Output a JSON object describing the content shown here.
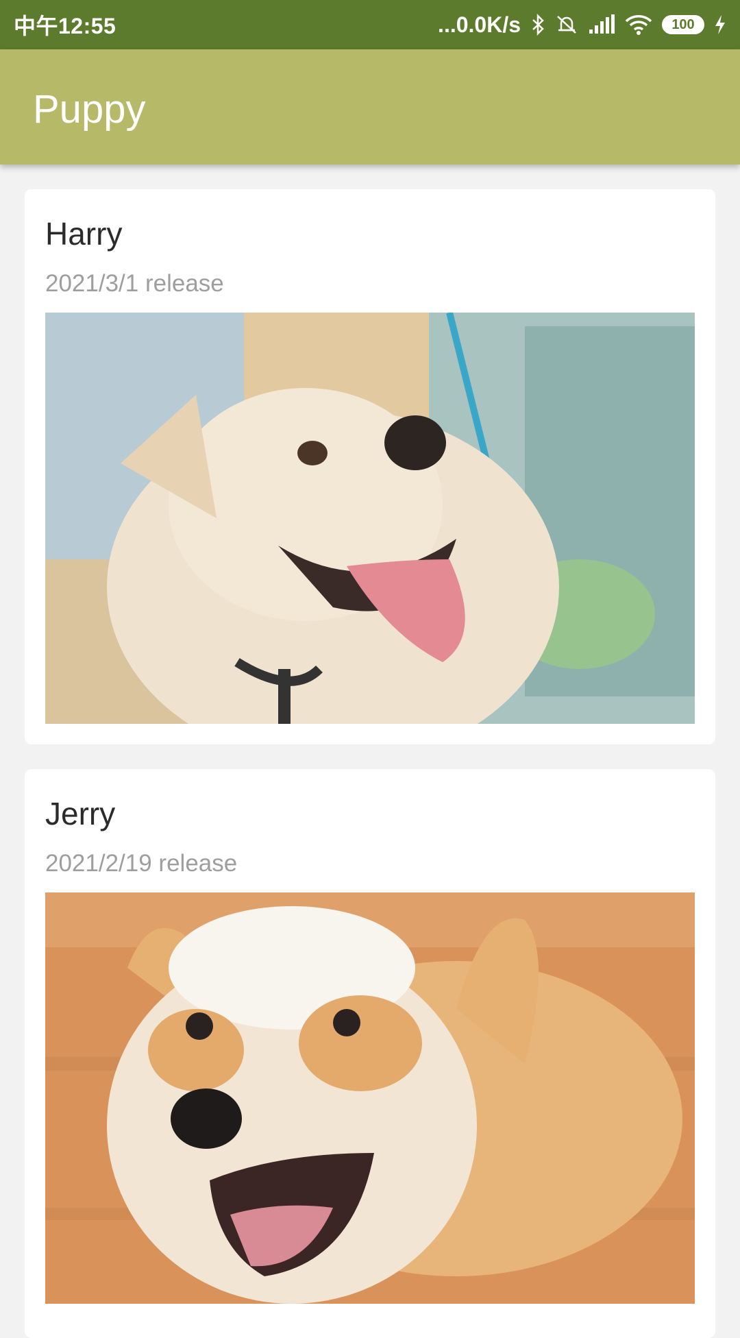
{
  "status_bar": {
    "time": "中午12:55",
    "network_speed": "...0.0K/s",
    "battery": "100"
  },
  "app_bar": {
    "title": "Puppy"
  },
  "puppies": [
    {
      "name": "Harry",
      "date": "2021/3/1 release"
    },
    {
      "name": "Jerry",
      "date": "2021/2/19 release"
    }
  ],
  "colors": {
    "status_bar": "#5d7b2c",
    "app_bar": "#b6b968",
    "background": "#f2f2f2"
  }
}
